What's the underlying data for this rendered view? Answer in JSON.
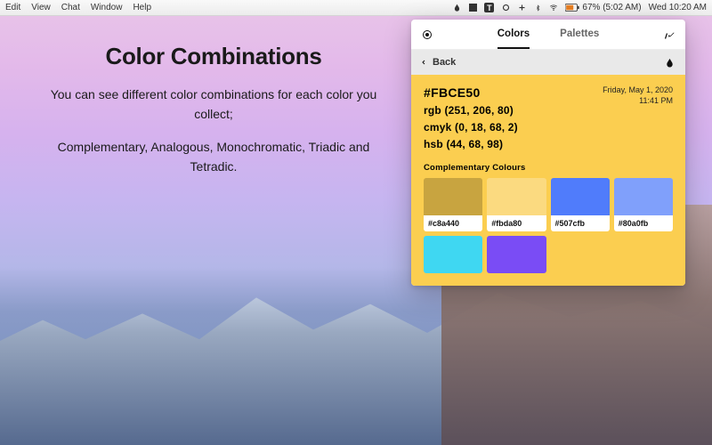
{
  "menubar": {
    "items": [
      "Edit",
      "View",
      "Chat",
      "Window",
      "Help"
    ],
    "battery": "67% (5:02 AM)",
    "clock": "Wed 10:20 AM"
  },
  "promo": {
    "title": "Color Combinations",
    "line1": "You can see different color combinations for each color you collect;",
    "line2": "Complementary, Analogous, Monochromatic, Triadic and Tetradic."
  },
  "panel": {
    "tabs": {
      "colors": "Colors",
      "palettes": "Palettes"
    },
    "back_label": "Back",
    "current": {
      "hex": "#FBCE50",
      "rgb": "rgb (251, 206, 80)",
      "cmyk": "cmyk (0, 18, 68, 2)",
      "hsb": "hsb (44, 68, 98)",
      "date": "Friday, May 1, 2020",
      "time": "11:41 PM",
      "bg_color": "#FBCE50"
    },
    "section_label": "Complementary Colours",
    "swatches": [
      {
        "hex": "#c8a440",
        "color": "#c8a440"
      },
      {
        "hex": "#fbda80",
        "color": "#fbda80"
      },
      {
        "hex": "#507cfb",
        "color": "#507cfb"
      },
      {
        "hex": "#80a0fb",
        "color": "#80a0fb"
      },
      {
        "hex": "",
        "color": "#3fd7f2"
      },
      {
        "hex": "",
        "color": "#7a4cf5"
      }
    ]
  }
}
